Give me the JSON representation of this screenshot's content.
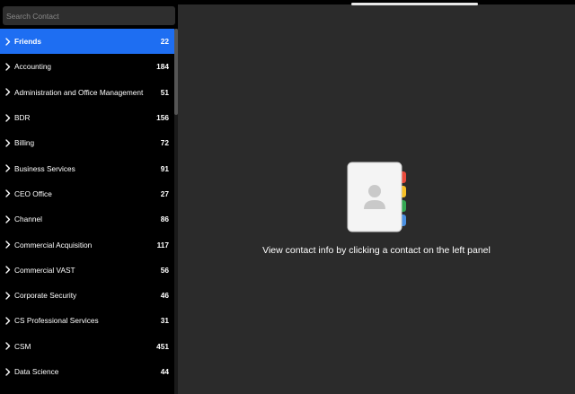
{
  "search": {
    "placeholder": "Search Contact"
  },
  "groups": [
    {
      "name": "Friends",
      "count": "22",
      "selected": true
    },
    {
      "name": "Accounting",
      "count": "184"
    },
    {
      "name": "Administration and Office Management",
      "count": "51"
    },
    {
      "name": "BDR",
      "count": "156"
    },
    {
      "name": "Billing",
      "count": "72"
    },
    {
      "name": "Business Services",
      "count": "91"
    },
    {
      "name": "CEO Office",
      "count": "27"
    },
    {
      "name": "Channel",
      "count": "86"
    },
    {
      "name": "Commercial Acquisition",
      "count": "117"
    },
    {
      "name": "Commercial VAST",
      "count": "56"
    },
    {
      "name": "Corporate Security",
      "count": "46"
    },
    {
      "name": "CS Professional Services",
      "count": "31"
    },
    {
      "name": "CSM",
      "count": "451"
    },
    {
      "name": "Data Science",
      "count": "44"
    }
  ],
  "main": {
    "empty_message": "View contact info by clicking a contact on the left panel",
    "illustration": "contact-book-icon"
  },
  "colors": {
    "selected": "#1e6ef2",
    "panel_bg": "#2b2b2b",
    "sidebar_bg": "#000000",
    "tab_red": "#e94b3c",
    "tab_yellow": "#f6bf26",
    "tab_green": "#34a853",
    "tab_blue": "#4a90e2"
  }
}
